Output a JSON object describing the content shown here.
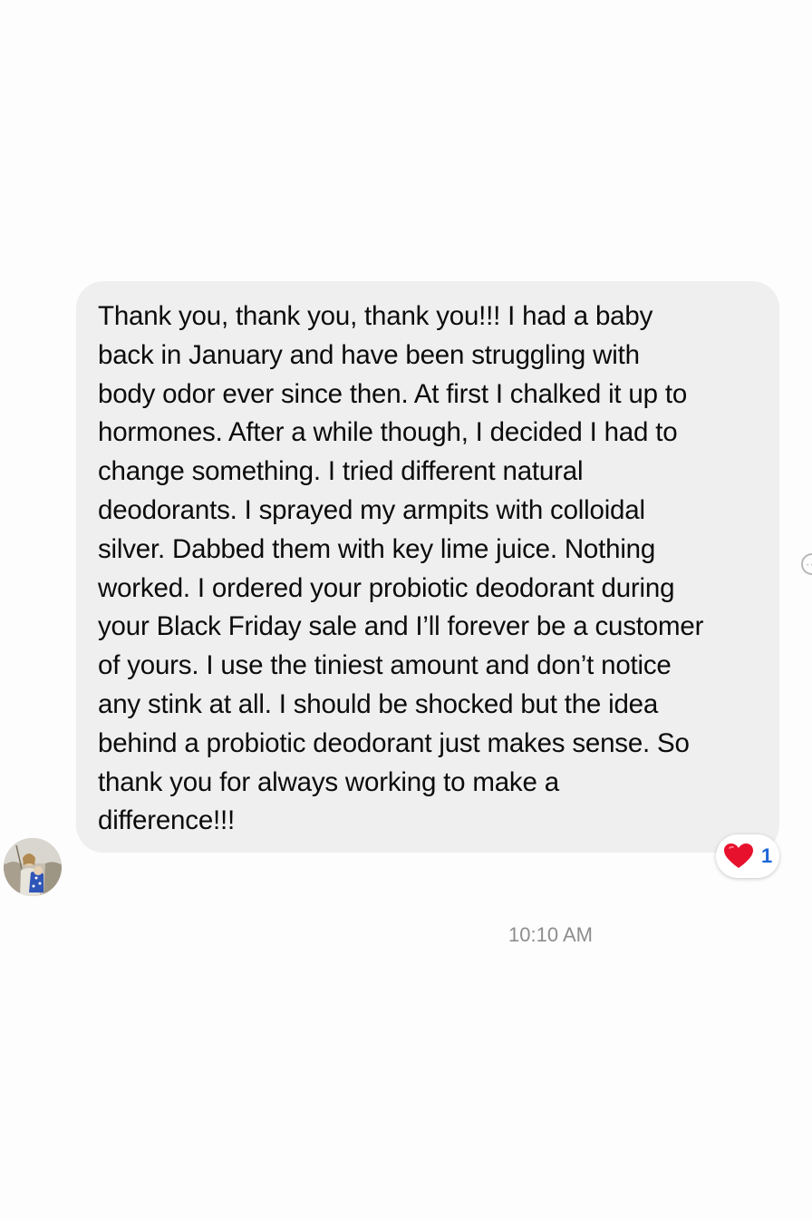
{
  "message": {
    "text": "Thank you, thank you, thank you!!! I had a baby\nback in January and have been struggling with\nbody odor ever since then. At first I chalked it up to\nhormones. After a while though, I decided I had to\nchange something. I tried different natural\ndeodorants. I sprayed my armpits with colloidal\nsilver. Dabbed them with key lime juice. Nothing\nworked. I ordered your probiotic deodorant during\nyour Black Friday sale and I’ll forever be a customer\nof yours. I use the tiniest amount and don’t notice\nany stink at all. I should be shocked but the idea\nbehind a probiotic deodorant just makes sense. So\nthank you for always working to make a\ndifference!!!",
    "timestamp": "10:10 AM"
  },
  "reaction": {
    "icon": "heart-icon",
    "count": "1",
    "heart_color": "#e8112d",
    "count_color": "#1d67d8"
  },
  "sender": {
    "avatar_icon": "avatar"
  },
  "colors": {
    "bubble_background": "#efefef",
    "page_background": "#fdfdfd",
    "timestamp": "#8d8d8d"
  }
}
